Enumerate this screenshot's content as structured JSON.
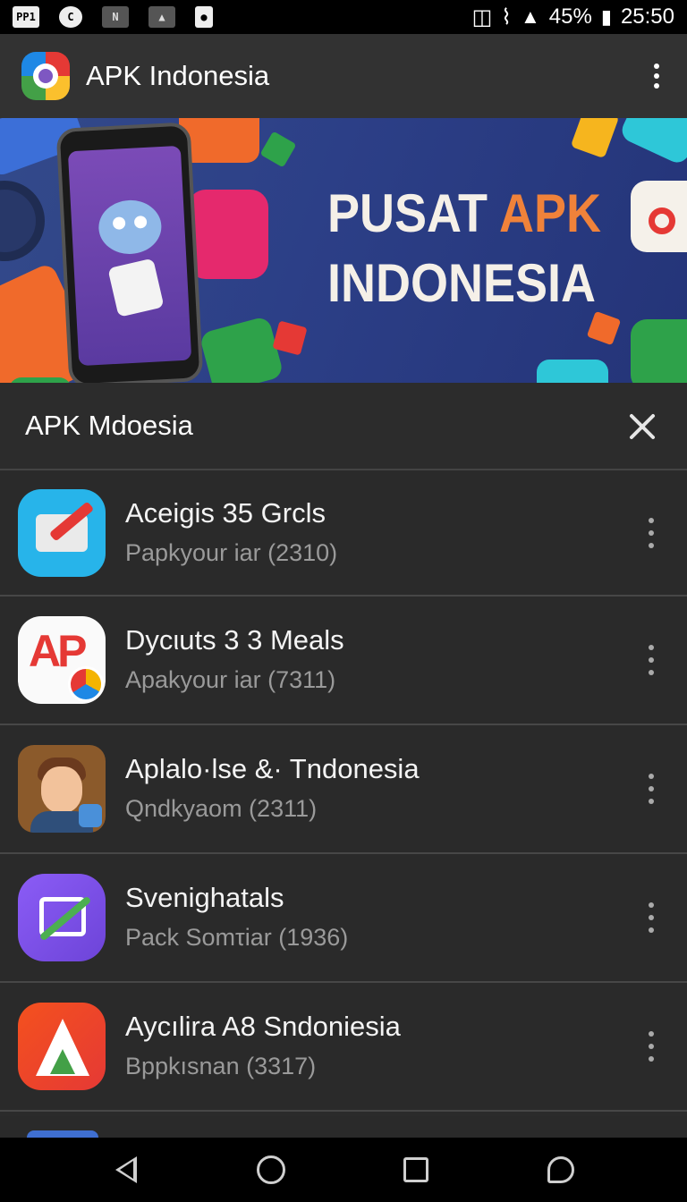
{
  "status_bar": {
    "left_icons": [
      "PP1",
      "signal-app-icon",
      "n-icon",
      "image-icon",
      "location-icon"
    ],
    "left_icon_text": "PP1",
    "battery_percent": "45%",
    "time": "25:50"
  },
  "app_bar": {
    "title": "APK Indonesia"
  },
  "banner": {
    "line1_main": "PUSAT ",
    "line1_accent": "APK",
    "line2": "INDONESIA"
  },
  "section": {
    "title": "APK Mdoesia"
  },
  "apps": [
    {
      "name": "Aceigis 35 Grcls",
      "sub": "Papkyour iar (2310)",
      "icon": "mail-check-icon"
    },
    {
      "name": "Dycιuts 3 3 Meals",
      "sub": "Apakyour iar (7311)",
      "icon": "ap-logo-icon"
    },
    {
      "name": "Aplalo·lse &· Tndonesia",
      "sub": "Qndkyaom (2311)",
      "icon": "avatar-person-icon"
    },
    {
      "name": "Svenighatals",
      "sub": "Pack Somτiar (1936)",
      "icon": "frame-slash-icon"
    },
    {
      "name": "Aycılira A8 Sndoniesia",
      "sub": "Bppkısnan (3317)",
      "icon": "triangle-a-icon"
    }
  ],
  "colors": {
    "status_bar_bg": "#000000",
    "app_bar_bg": "#323232",
    "list_bg": "#2a2a2a",
    "banner_accent": "#f0823a",
    "banner_bg": "#2c3f87"
  }
}
